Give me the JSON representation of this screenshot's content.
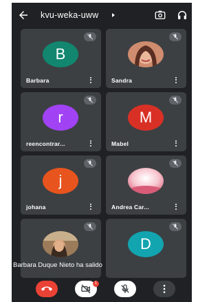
{
  "header": {
    "title": "kvu-weka-uww",
    "back_icon": "arrow-left-icon",
    "camera_switch_icon": "camera-flip-icon",
    "audio_icon": "headphones-icon"
  },
  "participants": [
    {
      "name": "Barbara",
      "initial": "B",
      "color": "#12866f",
      "muted": true
    },
    {
      "name": "Sandra",
      "photo": true,
      "muted": true
    },
    {
      "name": "reencontrar...",
      "initial": "r",
      "color": "#a142f4",
      "muted": true
    },
    {
      "name": "Mabel",
      "initial": "M",
      "color": "#d93025",
      "muted": true
    },
    {
      "name": "johana",
      "initial": "j",
      "color": "#e8541e",
      "muted": true
    },
    {
      "name": "Andrea Car...",
      "photo": true,
      "muted": true
    },
    {
      "name": "",
      "photo": true,
      "muted": true
    },
    {
      "name": "",
      "initial": "D",
      "color": "#12a4af",
      "muted": true
    }
  ],
  "toast": "Barbara Duque Nieto ha salido",
  "controls": {
    "end_call": "end-call-icon",
    "camera": "camera-off-icon",
    "camera_badge": "1",
    "mic": "mic-off-icon",
    "more": "more-vert-icon"
  }
}
